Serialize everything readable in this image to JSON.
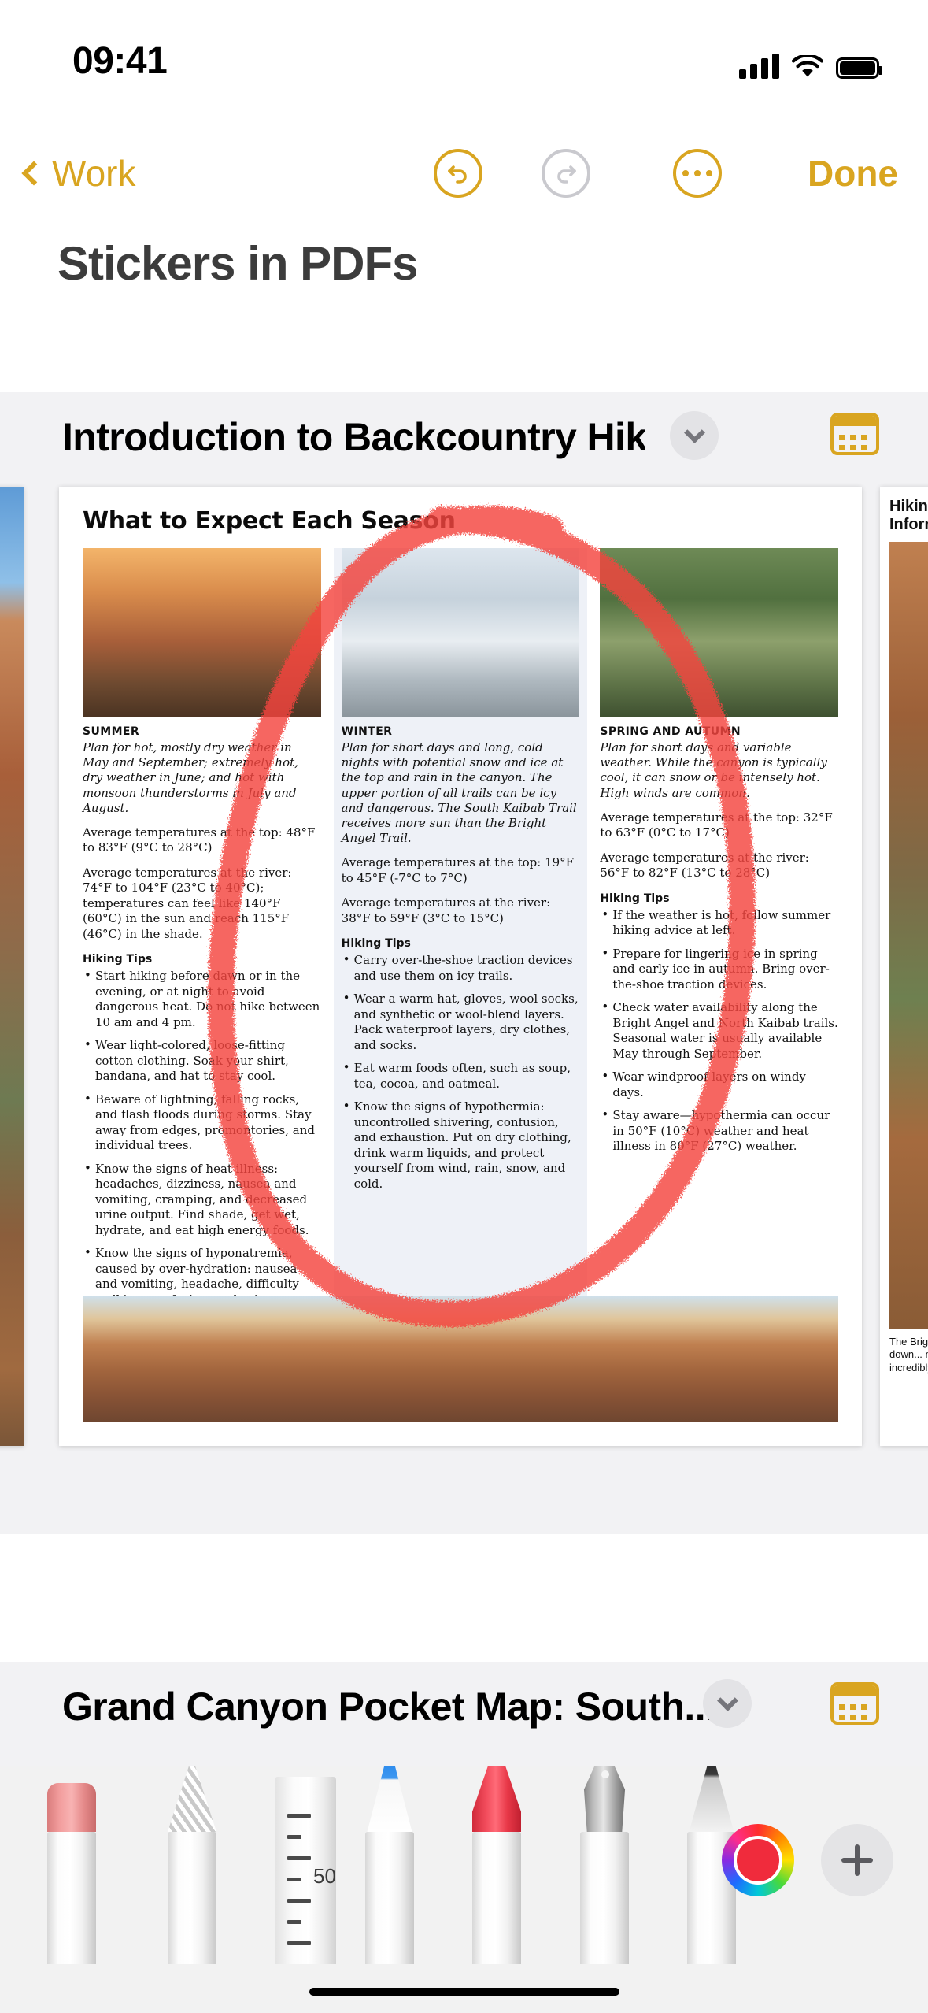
{
  "status_bar": {
    "time": "09:41",
    "icons": [
      "cellular-signal-icon",
      "wifi-icon",
      "battery-icon"
    ]
  },
  "nav_bar": {
    "back_label": "Work",
    "back_icon": "chevron-left-icon",
    "undo_icon": "undo-arrow-icon",
    "redo_icon": "redo-arrow-icon",
    "more_icon": "ellipsis-circle-icon",
    "done_label": "Done",
    "accent_color": "#D9A520",
    "disabled_color": "#C9C9CE"
  },
  "document": {
    "title": "Stickers in PDFs"
  },
  "attachments": [
    {
      "title": "Introduction to Backcountry Hiking",
      "collapse_icon": "chevron-down-icon",
      "page_view_icon": "page-grid-icon"
    },
    {
      "title": "Grand Canyon Pocket Map: South...",
      "collapse_icon": "chevron-down-icon",
      "page_view_icon": "page-grid-icon"
    }
  ],
  "pdf_page": {
    "heading": "What to Expect Each Season",
    "columns": [
      {
        "name": "SUMMER",
        "photo": "canyon-sunset-photo",
        "intro": "Plan for hot, mostly dry weather in May and September; extremely hot, dry weather in June; and hot with monsoon thunderstorms in July and August.",
        "temps": [
          "Average temperatures at the top: 48°F to 83°F (9°C to 28°C)",
          "Average temperatures at the river: 74°F to 104°F (23°C to 40°C); temperatures can feel like 140°F (60°C) in the sun and reach 115°F (46°C) in the shade."
        ],
        "temps_highlight": "like 140°F (60°C) in the sun and reach 115°F (46°C) in the shade.",
        "tips_label": "Hiking Tips",
        "tips": [
          "Start hiking before dawn or in the evening, or at night to avoid dangerous heat. Do not hike between 10 am and 4 pm.",
          "Wear light-colored, loose-fitting cotton clothing. Soak your shirt, bandana, and hat to stay cool.",
          "Beware of lightning, falling rocks, and flash floods during storms. Stay away from edges, promontories, and individual trees.",
          "Know the signs of heat illness: headaches, dizziness, nausea and vomiting, cramping, and decreased urine output. Find shade, get wet, hydrate, and eat high energy foods.",
          "Know the signs of hyponatremia, caused by over-hydration: nausea and vomiting, headache, difficulty walking, confusion, and seizures. Balance hydration with salty snacks, eat well-rounded meals, and rest frequently."
        ]
      },
      {
        "name": "WINTER",
        "photo": "snowy-trail-photo",
        "intro": "Plan for short days and long, cold nights with potential snow and ice at the top and rain in the canyon. The upper portion of all trails can be icy and dangerous. The South Kaibab Trail receives more sun than the Bright Angel Trail.",
        "temps": [
          "Average temperatures at the top: 19°F to 45°F (-7°C to 7°C)",
          "Average temperatures at the river: 38°F to 59°F (3°C to 15°C)"
        ],
        "tips_label": "Hiking Tips",
        "tips": [
          "Carry over-the-shoe traction devices and use them on icy trails.",
          "Wear a warm hat, gloves, wool socks, and synthetic or wool-blend layers. Pack waterproof layers, dry clothes, and socks.",
          "Eat warm foods often, such as soup, tea, cocoa, and oatmeal.",
          "Know the signs of hypothermia: uncontrolled shivering, confusion, and exhaustion. Put on dry clothing, drink warm liquids, and protect yourself from wind, rain, snow, and cold."
        ]
      },
      {
        "name": "SPRING AND AUTUMN",
        "photo": "hiker-water-station-photo",
        "intro": "Plan for short days and variable weather. While the canyon is typically cool, it can snow or be intensely hot. High winds are common.",
        "temps": [
          "Average temperatures at the top: 32°F to 63°F (0°C to 17°C)",
          "Average temperatures at the river: 56°F to 82°F (13°C to 28°C)"
        ],
        "tips_label": "Hiking Tips",
        "tips": [
          "If the weather is hot, follow summer hiking advice at left.",
          "Prepare for lingering ice in spring and early ice in autumn. Bring over-the-shoe traction devices.",
          "Check water availability along the Bright Angel and North Kaibab trails. Seasonal water is usually available May through September.",
          "Wear windproof layers on windy days.",
          "Stay aware—hypothermia can occur in 50°F (10°C) weather and heat illness in 80°F (27°C) weather."
        ]
      }
    ],
    "bottom_photo": "canyon-panorama-photo"
  },
  "pdf_page_next": {
    "heading": "Hiking Information",
    "caption": "The Bright Angel Fault down... maintained... incredibly..."
  },
  "annotation": {
    "type": "freehand-circle",
    "color": "#F4443E",
    "stroke_width": 34,
    "tool": "marker"
  },
  "toolbar": {
    "tools": [
      {
        "name": "eraser-tool",
        "label": "Eraser"
      },
      {
        "name": "shaded-pencil-tool",
        "label": "Shaded Pencil"
      },
      {
        "name": "ruler-tool",
        "label": "Ruler"
      },
      {
        "name": "pen-tool",
        "label": "Pen"
      },
      {
        "name": "marker-tool",
        "label": "Marker"
      },
      {
        "name": "fountain-pen-tool",
        "label": "Fountain Pen"
      },
      {
        "name": "pencil-tool",
        "label": "Pencil"
      }
    ],
    "size_value": "50",
    "color_wheel_icon": "color-wheel-icon",
    "selected_color": "#F02B3C",
    "add_icon": "plus-icon"
  }
}
